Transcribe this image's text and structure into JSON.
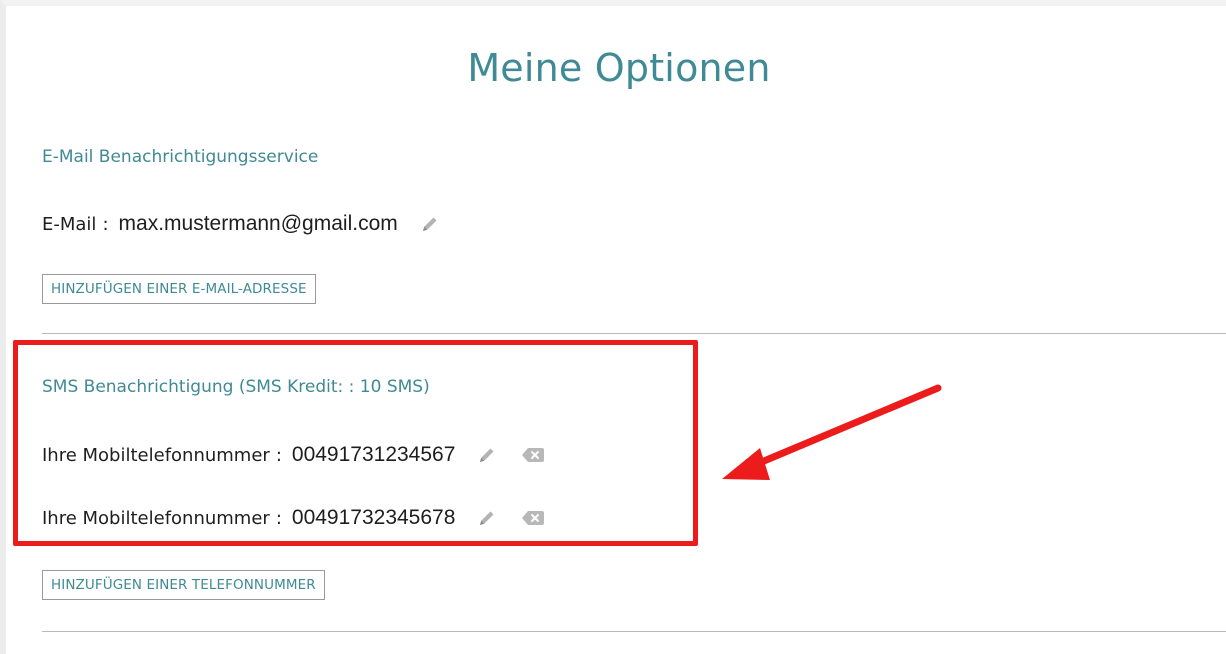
{
  "page": {
    "title": "Meine Optionen"
  },
  "email_section": {
    "title": "E-Mail Benachrichtigungsservice",
    "label": "E-Mail",
    "separator": ":",
    "value": "max.mustermann@gmail.com",
    "edit_icon": "pencil-icon",
    "add_button_label": "HINZUFÜGEN EINER E-MAIL-ADRESSE"
  },
  "sms_section": {
    "title": "SMS Benachrichtigung (SMS Kredit: : 10 SMS)",
    "phones": [
      {
        "label": "Ihre Mobiltelefonnummer",
        "separator": ":",
        "value": "00491731234567",
        "edit_icon": "pencil-icon",
        "delete_icon": "backspace-delete-icon"
      },
      {
        "label": "Ihre Mobiltelefonnummer",
        "separator": ":",
        "value": "00491732345678",
        "edit_icon": "pencil-icon",
        "delete_icon": "backspace-delete-icon"
      }
    ],
    "add_button_label": "HINZUFÜGEN EINER TELEFONNUMMER"
  },
  "colors": {
    "accent": "#3f8a94",
    "highlight": "#ec1c1c",
    "divider": "#b9b9b9",
    "icon_gray": "#b3b3b3"
  }
}
